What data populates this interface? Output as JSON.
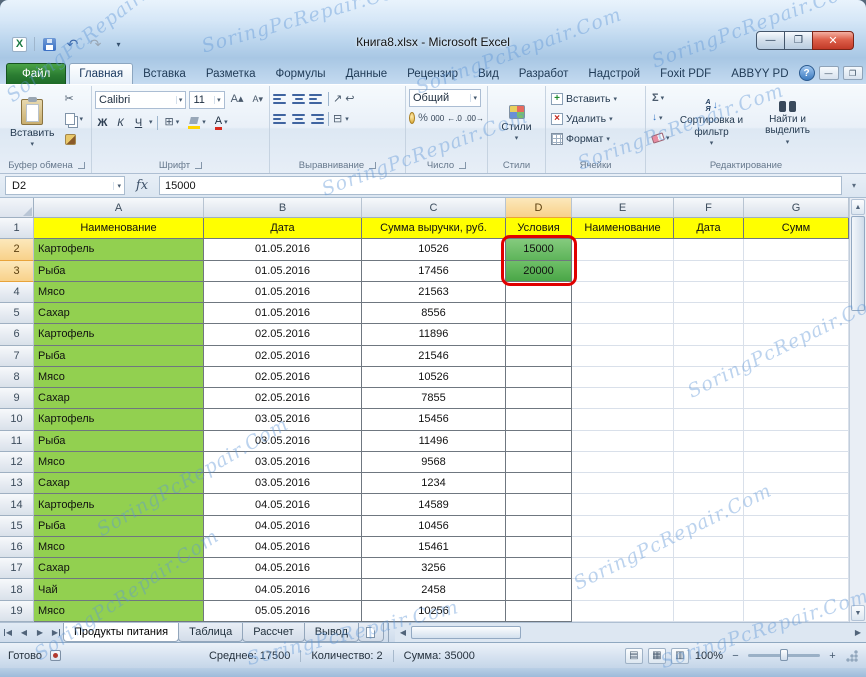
{
  "watermark": {
    "text": "SoringPcRepair.Com"
  },
  "window": {
    "title": "Книга8.xlsx - Microsoft Excel"
  },
  "ribbon": {
    "file_tab": "Файл",
    "active_tab": "Главная",
    "tabs": [
      "Главная",
      "Вставка",
      "Разметка",
      "Формулы",
      "Данные",
      "Рецензир",
      "Вид",
      "Разработ",
      "Надстрой",
      "Foxit PDF",
      "ABBYY PD"
    ],
    "help": "?",
    "clipboard": {
      "label": "Буфер обмена",
      "paste": "Вставить"
    },
    "font": {
      "label": "Шрифт",
      "font_name": "Calibri",
      "font_size": "11",
      "bold": "Ж",
      "italic": "К",
      "underline": "Ч"
    },
    "alignment": {
      "label": "Выравнивание"
    },
    "number": {
      "label": "Число",
      "format": "Общий",
      "thousands": "000"
    },
    "styles": {
      "label": "Стили",
      "button": "Стили"
    },
    "cells": {
      "label": "Ячейки",
      "insert": "Вставить",
      "delete": "Удалить",
      "format": "Формат"
    },
    "editing": {
      "label": "Редактирование",
      "autosum": "Σ",
      "sort": "Сортировка и фильтр",
      "find": "Найти и выделить"
    }
  },
  "formula_bar": {
    "name_box": "D2",
    "fx": "fx",
    "value": "15000"
  },
  "sheet": {
    "columns": [
      "A",
      "B",
      "C",
      "D",
      "E",
      "F",
      "G"
    ],
    "header_row": [
      "Наименование",
      "Дата",
      "Сумма выручки, руб.",
      "Условия",
      "Наименование",
      "Дата",
      "Сумм"
    ],
    "rows": [
      {
        "n": "2",
        "a": "Картофель",
        "b": "01.05.2016",
        "c": "10526",
        "d": "15000"
      },
      {
        "n": "3",
        "a": "Рыба",
        "b": "01.05.2016",
        "c": "17456",
        "d": "20000"
      },
      {
        "n": "4",
        "a": "Мясо",
        "b": "01.05.2016",
        "c": "21563",
        "d": ""
      },
      {
        "n": "5",
        "a": "Сахар",
        "b": "01.05.2016",
        "c": "8556",
        "d": ""
      },
      {
        "n": "6",
        "a": "Картофель",
        "b": "02.05.2016",
        "c": "11896",
        "d": ""
      },
      {
        "n": "7",
        "a": "Рыба",
        "b": "02.05.2016",
        "c": "21546",
        "d": ""
      },
      {
        "n": "8",
        "a": "Мясо",
        "b": "02.05.2016",
        "c": "10526",
        "d": ""
      },
      {
        "n": "9",
        "a": "Сахар",
        "b": "02.05.2016",
        "c": "7855",
        "d": ""
      },
      {
        "n": "10",
        "a": "Картофель",
        "b": "03.05.2016",
        "c": "15456",
        "d": ""
      },
      {
        "n": "11",
        "a": "Рыба",
        "b": "03.05.2016",
        "c": "11496",
        "d": ""
      },
      {
        "n": "12",
        "a": "Мясо",
        "b": "03.05.2016",
        "c": "9568",
        "d": ""
      },
      {
        "n": "13",
        "a": "Сахар",
        "b": "03.05.2016",
        "c": "1234",
        "d": ""
      },
      {
        "n": "14",
        "a": "Картофель",
        "b": "04.05.2016",
        "c": "14589",
        "d": ""
      },
      {
        "n": "15",
        "a": "Рыба",
        "b": "04.05.2016",
        "c": "10456",
        "d": ""
      },
      {
        "n": "16",
        "a": "Мясо",
        "b": "04.05.2016",
        "c": "15461",
        "d": ""
      },
      {
        "n": "17",
        "a": "Сахар",
        "b": "04.05.2016",
        "c": "3256",
        "d": ""
      },
      {
        "n": "18",
        "a": "Чай",
        "b": "04.05.2016",
        "c": "2458",
        "d": ""
      },
      {
        "n": "19",
        "a": "Мясо",
        "b": "05.05.2016",
        "c": "10256",
        "d": ""
      }
    ],
    "selected_range": "D2:D3",
    "colors": {
      "header_fill": "#ffff00",
      "name_fill": "#92d050",
      "cond_fill_1": "#73c36d",
      "cond_fill_2": "#53ae50",
      "annotation": "#e00000"
    }
  },
  "sheet_tabs": [
    "Продукты питания",
    "Таблица",
    "Рассчет",
    "Вывод"
  ],
  "active_sheet": "Продукты питания",
  "status_bar": {
    "mode": "Готово",
    "average": "Среднее: 17500",
    "count": "Количество: 2",
    "sum": "Сумма: 35000",
    "zoom": "100%"
  }
}
